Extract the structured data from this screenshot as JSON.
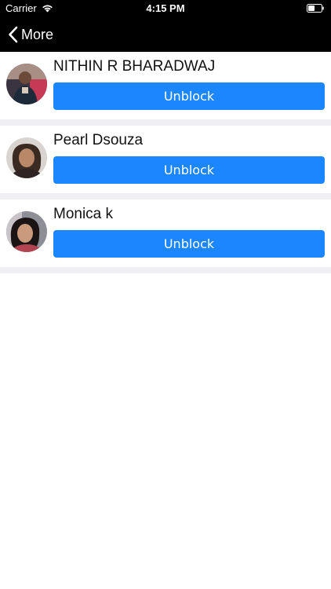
{
  "status_bar": {
    "carrier": "Carrier",
    "time": "4:15 PM",
    "wifi_icon": "wifi-icon",
    "battery_icon": "battery-icon"
  },
  "nav": {
    "back_label": "More",
    "back_icon": "chevron-left-icon"
  },
  "blocked_users": [
    {
      "name": "NITHIN R BHARADWAJ",
      "action_label": "Unblock",
      "avatar": "profile-photo"
    },
    {
      "name": "Pearl Dsouza",
      "action_label": "Unblock",
      "avatar": "profile-photo"
    },
    {
      "name": "Monica k",
      "action_label": "Unblock",
      "avatar": "profile-photo"
    }
  ],
  "colors": {
    "nav_background": "#000000",
    "button_background": "#1c86ff",
    "separator": "#efeff4"
  }
}
